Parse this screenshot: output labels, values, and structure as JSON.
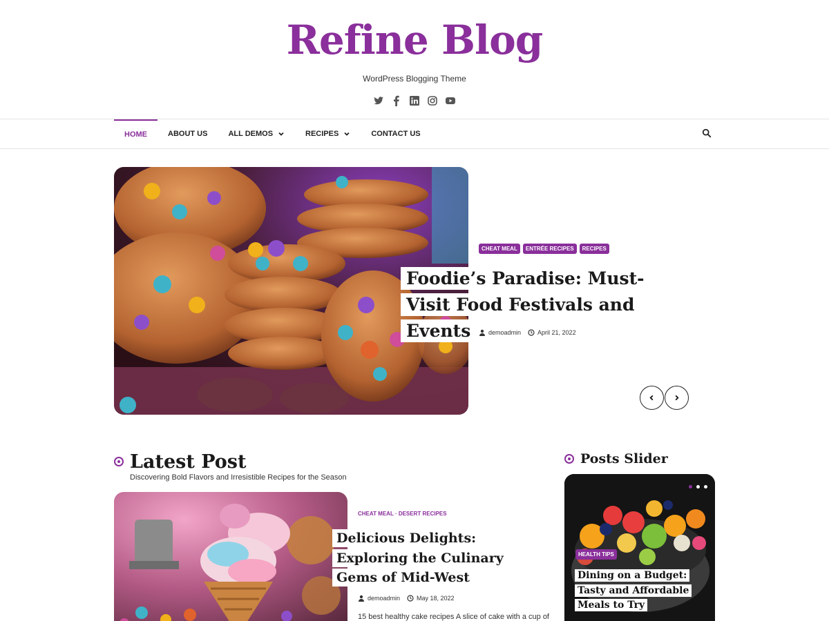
{
  "site": {
    "title": "Refine Blog",
    "tagline": "WordPress Blogging Theme",
    "social": [
      "twitter-icon",
      "facebook-icon",
      "linkedin-icon",
      "instagram-icon",
      "youtube-icon"
    ],
    "accent_color": "#8a2f9b"
  },
  "nav": {
    "items": [
      {
        "label": "HOME",
        "active": true
      },
      {
        "label": "ABOUT US"
      },
      {
        "label": "ALL DEMOS",
        "has_dropdown": true
      },
      {
        "label": "RECIPES",
        "has_dropdown": true
      },
      {
        "label": "CONTACT US"
      }
    ],
    "search_icon": "search-icon"
  },
  "hero": {
    "tags": [
      "CHEAT MEAL",
      "ENTRÉE RECIPES",
      "RECIPES"
    ],
    "title": "Foodie’s Paradise: Must-Visit Food Festivals and Events",
    "author": "demoadmin",
    "date": "April 21, 2022",
    "image": "cookies-photo"
  },
  "latest": {
    "heading": "Latest Post",
    "subheading": "Discovering Bold Flavors and Irresistible Recipes for the Season",
    "post": {
      "categories": "CHEAT MEAL · DESERT RECIPES",
      "title": "Delicious Delights: Exploring the Culinary Gems of Mid-West",
      "author": "demoadmin",
      "date": "May 18, 2022",
      "excerpt": "15 best healthy cake recipes A slice of cake with a cup of",
      "image": "ice-cream-cone-photo"
    }
  },
  "slider": {
    "heading": "Posts Slider",
    "slide": {
      "tag": "HEALTH TIPS",
      "title": "Dining on a Budget: Tasty and Affordable Meals to Try",
      "image": "fruit-bowl-photo"
    }
  }
}
